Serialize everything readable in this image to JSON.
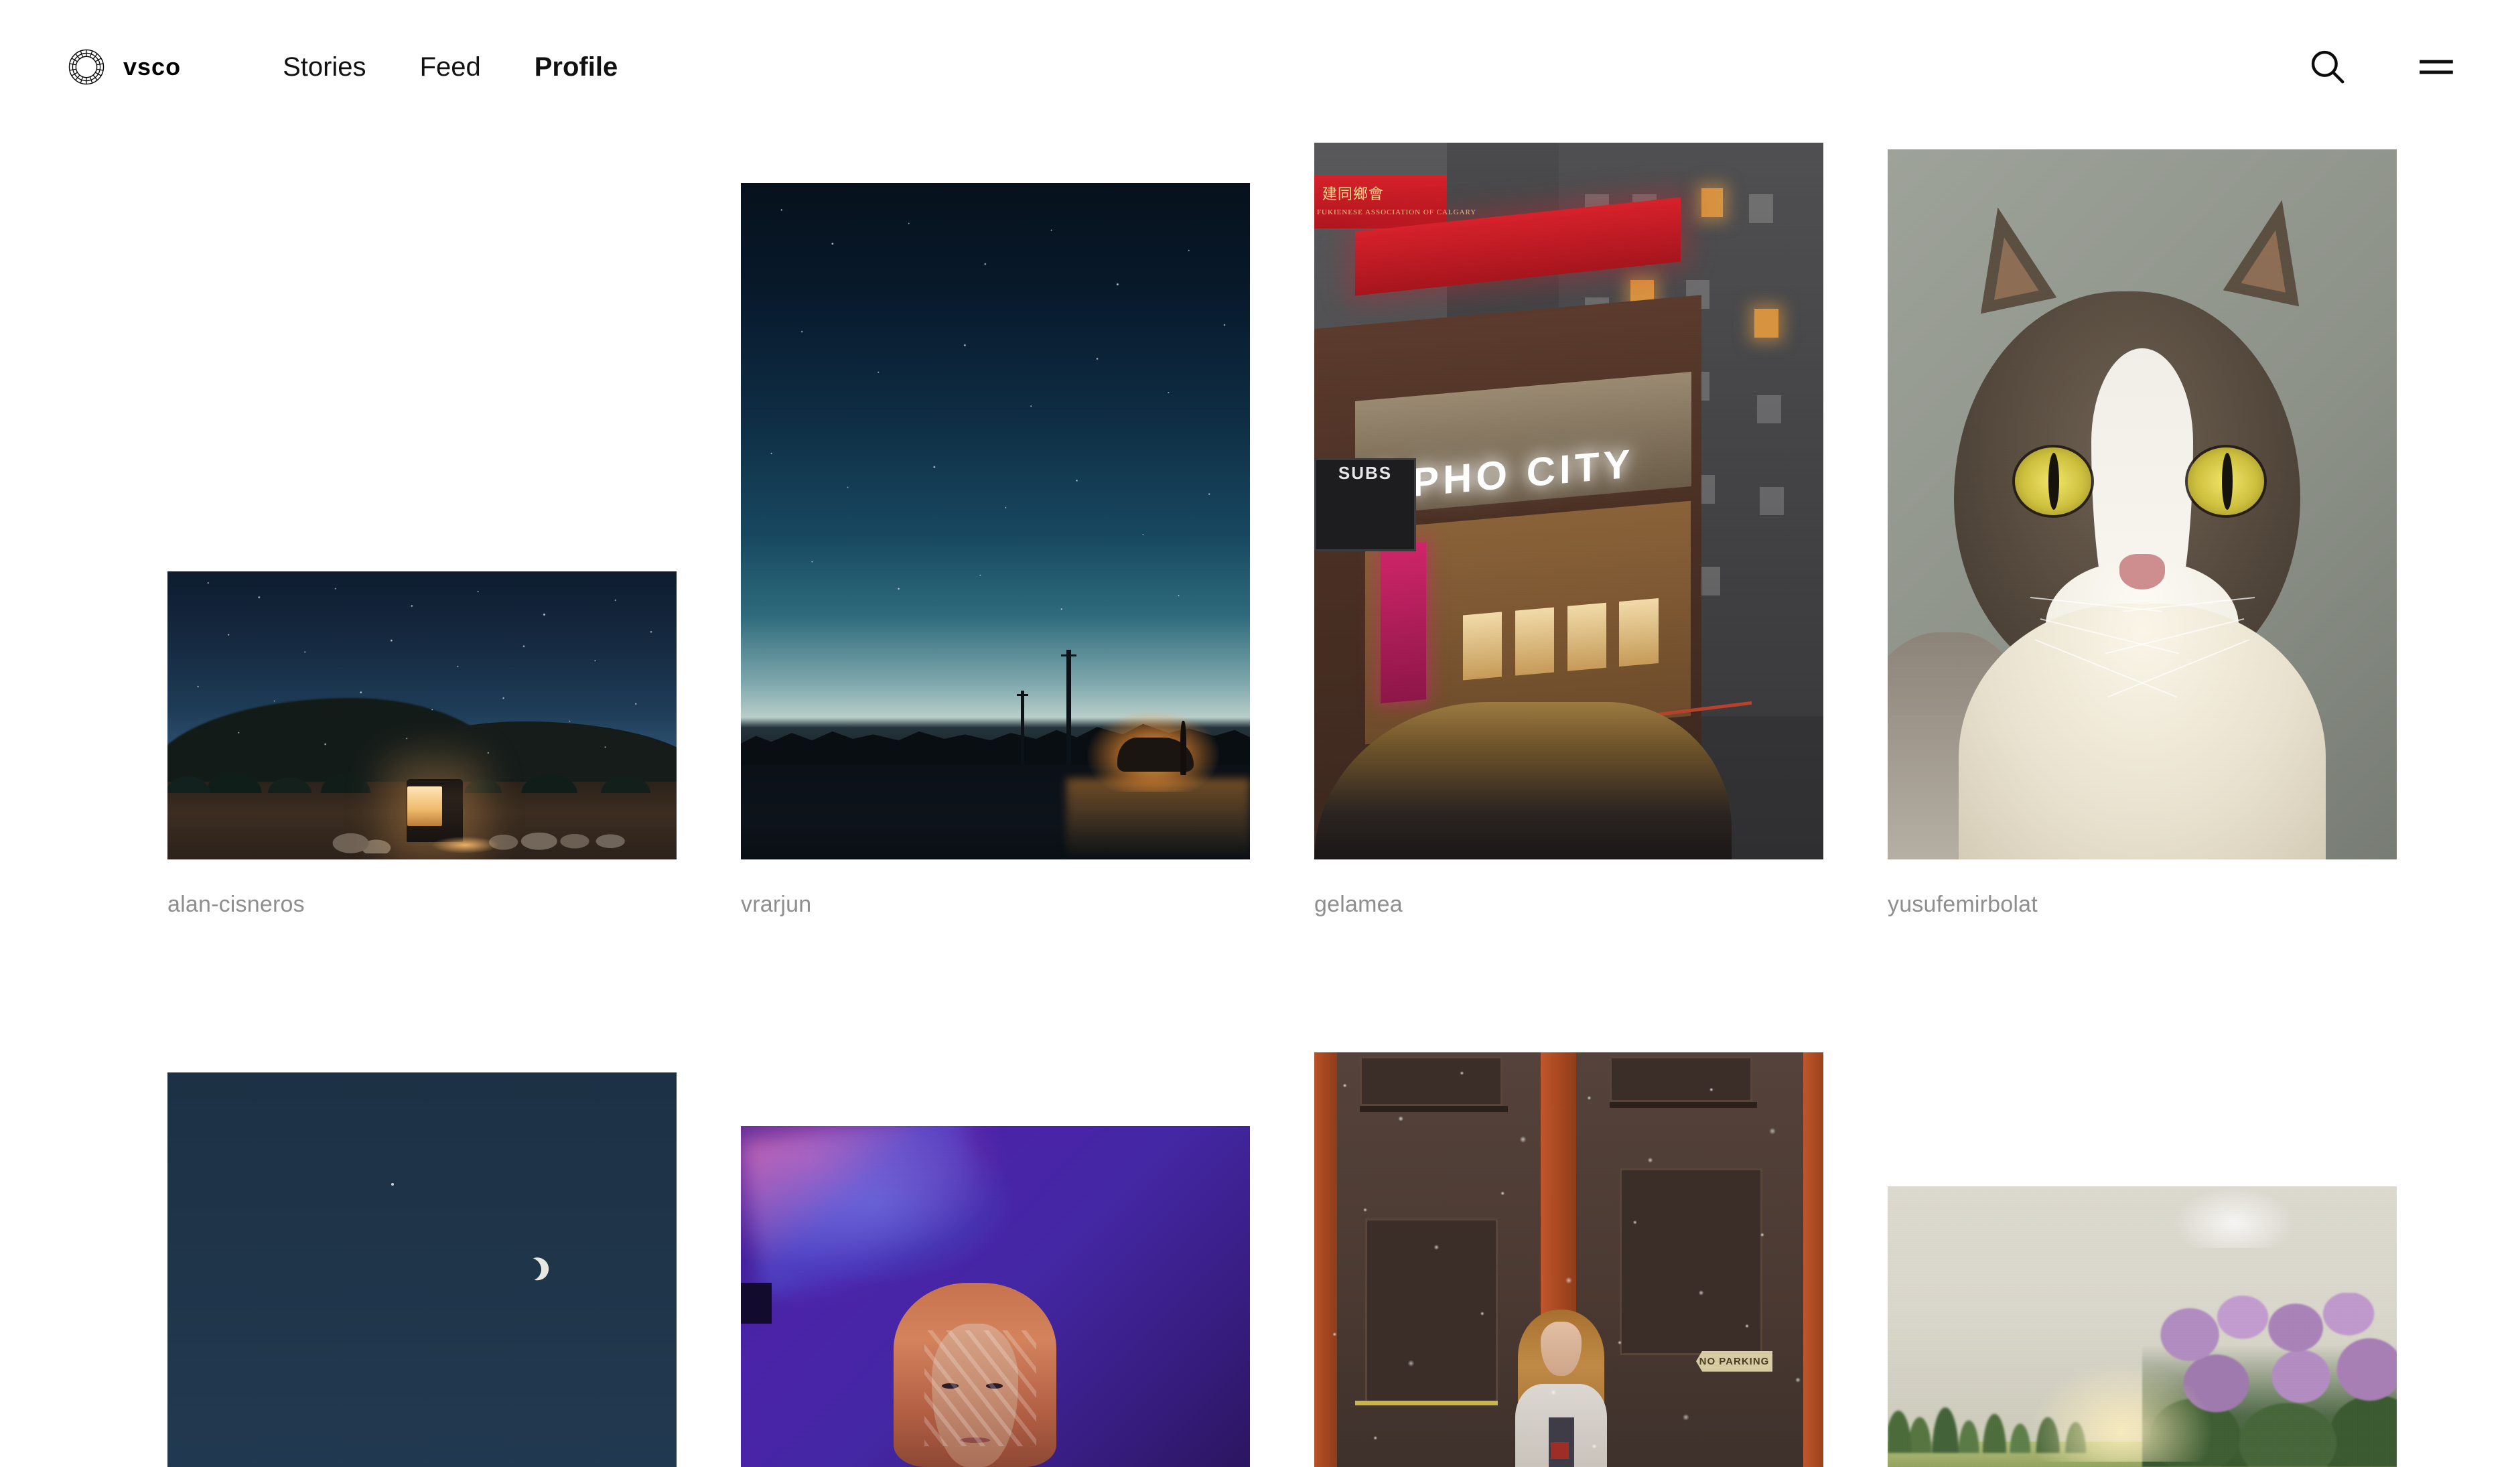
{
  "header": {
    "brand_name": "vsco",
    "logo_icon": "vsco-ring-logo-icon",
    "nav": [
      {
        "label": "Stories",
        "active": false
      },
      {
        "label": "Feed",
        "active": false
      },
      {
        "label": "Profile",
        "active": true
      }
    ],
    "actions": [
      {
        "name": "search-icon",
        "label": "Search"
      },
      {
        "name": "hamburger-menu-icon",
        "label": "Menu"
      }
    ]
  },
  "grid": {
    "row1": [
      {
        "username": "alan-cisneros",
        "alt": "Night desert campsite with an illuminated open SUV under a starry sky"
      },
      {
        "username": "vrarjun",
        "alt": "Starry night sky over a rural road with a car's headlights glowing"
      },
      {
        "username": "gelamea",
        "alt": "PHO CITY neon storefront at night in Calgary Chinatown",
        "signs": {
          "neon": "PHO CITY",
          "banner_top": "FUKIENESE ASSOCIATION OF CALGARY",
          "neighbor": "SUBS"
        }
      },
      {
        "username": "yusufemirbolat",
        "alt": "Close-up portrait of a tabby and white cat with yellow-green eyes"
      }
    ],
    "row2": [
      {
        "username": "",
        "alt": "Deep blue night sky with a thin crescent moon"
      },
      {
        "username": "",
        "alt": "Portrait of a woman lit by blue and magenta projected light"
      },
      {
        "username": "",
        "alt": "Woman standing in falling snow before a brown building with orange pillars",
        "signs": {
          "street_sign": "NO PARKING"
        }
      },
      {
        "username": "",
        "alt": "Hazy film photograph of lilac bushes and pine trees at golden hour"
      }
    ]
  },
  "colors": {
    "background": "#ffffff",
    "text": "#111111",
    "caption": "#8e8e8e",
    "accent": "#000000"
  }
}
